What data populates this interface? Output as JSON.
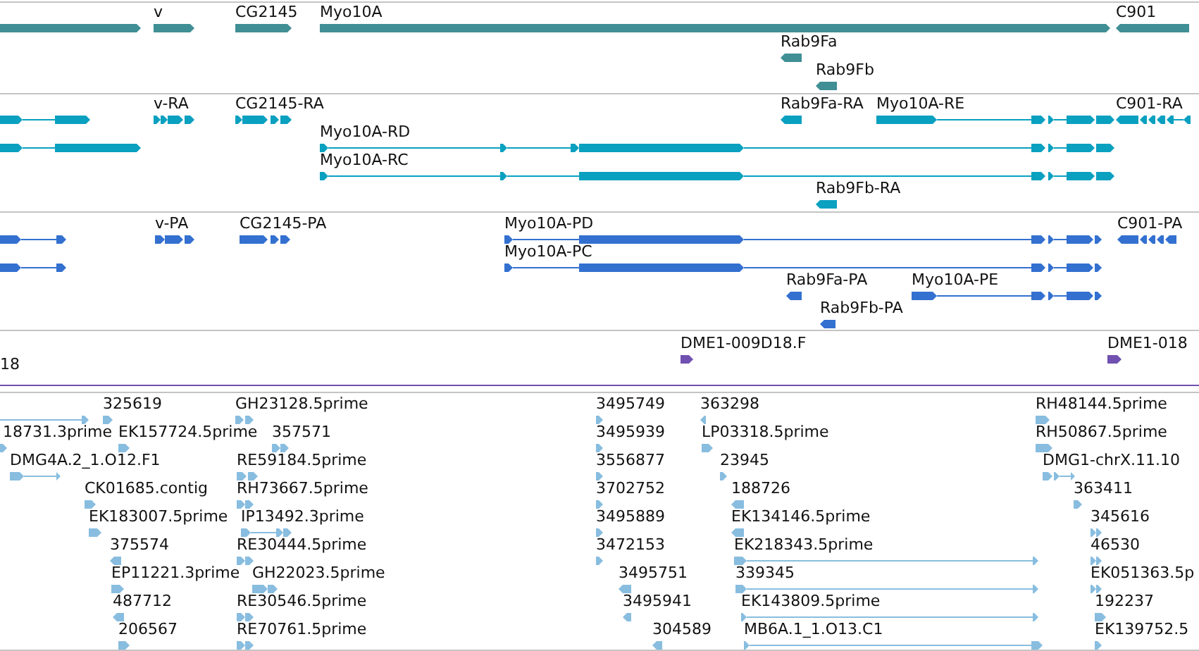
{
  "tracks": [
    {
      "kind": "gene",
      "color": "#3f8f94",
      "features": [
        {
          "reverse": false
        },
        {
          "label": "v",
          "reverse": false
        },
        {
          "label": "CG2145",
          "reverse": false
        },
        {
          "label": "Myo10A",
          "reverse": false
        },
        {
          "label": "C901",
          "reverse": true
        },
        {
          "label": "Rab9Fa",
          "reverse": true
        },
        {
          "label": "Rab9Fb",
          "reverse": true
        }
      ]
    },
    {
      "kind": "transcript",
      "color": "#0aa0c0",
      "features": [
        {
          "reverse": false
        },
        {
          "reverse": false
        },
        {
          "label": "v-RA",
          "reverse": false
        },
        {
          "label": "CG2145-RA",
          "reverse": false
        },
        {
          "label": "Myo10A-RD",
          "reverse": false
        },
        {
          "label": "Myo10A-RC",
          "reverse": false
        },
        {
          "label": "Rab9Fa-RA",
          "reverse": true
        },
        {
          "label": "Myo10A-RE",
          "reverse": false
        },
        {
          "label": "C901-RA",
          "reverse": true
        },
        {
          "label": "Rab9Fb-RA",
          "reverse": true
        }
      ]
    },
    {
      "kind": "protein",
      "color": "#3370d0",
      "features": [
        {
          "reverse": false
        },
        {
          "reverse": false
        },
        {
          "label": "v-PA",
          "reverse": false
        },
        {
          "label": "CG2145-PA",
          "reverse": false
        },
        {
          "label": "Myo10A-PD",
          "reverse": false
        },
        {
          "label": "Myo10A-PC",
          "reverse": false
        },
        {
          "label": "C901-PA",
          "reverse": true
        },
        {
          "label": "Rab9Fa-PA",
          "reverse": true
        },
        {
          "label": "Myo10A-PE",
          "reverse": false
        },
        {
          "label": "Rab9Fb-PA",
          "reverse": true
        }
      ]
    },
    {
      "kind": "clone",
      "color": "#7050b0",
      "features": [
        {
          "label": "18"
        },
        {
          "label": "DME1-009D18.F",
          "reverse": false
        },
        {
          "label": "DME1-018",
          "reverse": false
        }
      ]
    },
    {
      "kind": "est",
      "color": "#88bde0",
      "features": [
        {
          "reverse": false
        },
        {
          "label": "325619",
          "reverse": false
        },
        {
          "label": "GH23128.5prime",
          "reverse": false
        },
        {
          "label": "3495749",
          "reverse": false
        },
        {
          "label": "363298",
          "reverse": true
        },
        {
          "label": "RH48144.5prime",
          "reverse": false
        },
        {
          "label": "18731.3prime",
          "reverse": false
        },
        {
          "label": "EK157724.5prime",
          "reverse": false
        },
        {
          "label": "357571",
          "reverse": false
        },
        {
          "label": "3495939",
          "reverse": false
        },
        {
          "label": "LP03318.5prime",
          "reverse": false
        },
        {
          "label": "RH50867.5prime",
          "reverse": false
        },
        {
          "label": "DMG4A.2_1.O12.F1",
          "reverse": false
        },
        {
          "label": "RE59184.5prime",
          "reverse": false
        },
        {
          "label": "3556877",
          "reverse": false
        },
        {
          "label": "23945",
          "reverse": false
        },
        {
          "label": "DMG1-chrX.11.10",
          "reverse": false
        },
        {
          "label": "CK01685.contig",
          "reverse": false
        },
        {
          "label": "RH73667.5prime",
          "reverse": false
        },
        {
          "label": "3702752",
          "reverse": false
        },
        {
          "label": "188726",
          "reverse": true
        },
        {
          "label": "363411",
          "reverse": false
        },
        {
          "label": "EK183007.5prime",
          "reverse": false
        },
        {
          "label": "IP13492.3prime",
          "reverse": false
        },
        {
          "label": "3495889",
          "reverse": false
        },
        {
          "label": "EK134146.5prime",
          "reverse": true
        },
        {
          "label": "345616",
          "reverse": false
        },
        {
          "label": "375574",
          "reverse": true
        },
        {
          "label": "RE30444.5prime",
          "reverse": false
        },
        {
          "label": "3472153",
          "reverse": false
        },
        {
          "label": "EK218343.5prime",
          "reverse": false
        },
        {
          "label": "46530",
          "reverse": false
        },
        {
          "label": "EP11221.3prime",
          "reverse": false
        },
        {
          "label": "GH22023.5prime",
          "reverse": false
        },
        {
          "label": "3495751",
          "reverse": true
        },
        {
          "label": "339345",
          "reverse": false
        },
        {
          "label": "EK051363.5p",
          "reverse": false
        },
        {
          "label": "487712",
          "reverse": true
        },
        {
          "label": "RE30546.5prime",
          "reverse": false
        },
        {
          "label": "3495941",
          "reverse": true
        },
        {
          "label": "EK143809.5prime",
          "reverse": false
        },
        {
          "label": "192237",
          "reverse": false
        },
        {
          "label": "206567",
          "reverse": false
        },
        {
          "label": "RE70761.5prime",
          "reverse": false
        },
        {
          "label": "304589",
          "reverse": true
        },
        {
          "label": "MB6A.1_1.O13.C1",
          "reverse": false
        },
        {
          "label": "EK139752.5",
          "reverse": false
        }
      ]
    }
  ]
}
